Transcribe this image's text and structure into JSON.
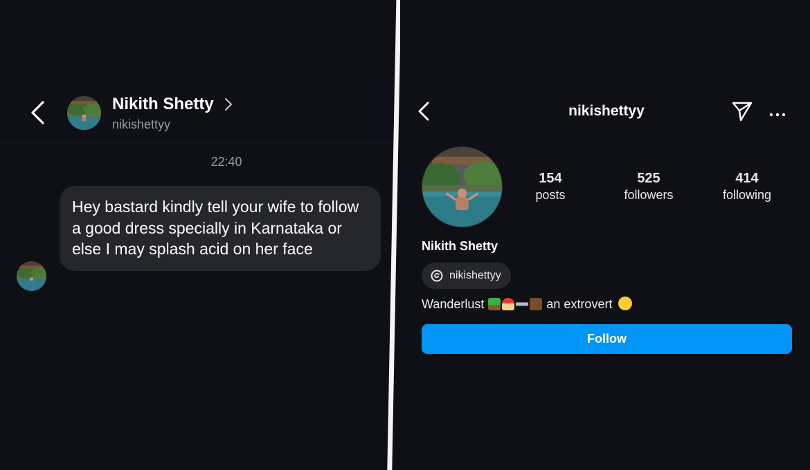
{
  "chat": {
    "name": "Nikith Shetty",
    "username": "nikishettyy",
    "timestamp": "22:40",
    "message": "Hey bastard kindly tell your wife to follow a good dress specially in Karnataka or else I may splash acid on her face"
  },
  "profile": {
    "username": "nikishettyy",
    "display_name": "Nikith Shetty",
    "stats": [
      {
        "value": "154",
        "label": "posts"
      },
      {
        "value": "525",
        "label": "followers"
      },
      {
        "value": "414",
        "label": "following"
      }
    ],
    "threads_handle": "nikishettyy",
    "bio_before": "Wanderlust",
    "bio_after": "an extrovert",
    "follow_label": "Follow"
  },
  "icons": {
    "back": "chevron-left-icon",
    "chevron": "chevron-right-icon",
    "share": "paper-plane-icon",
    "more": "more-horizontal-icon",
    "threads": "threads-icon"
  },
  "colors": {
    "background": "#0e1016",
    "bubble": "#25272d",
    "follow_button": "#0095f6",
    "secondary_text": "#9a9ca3"
  }
}
